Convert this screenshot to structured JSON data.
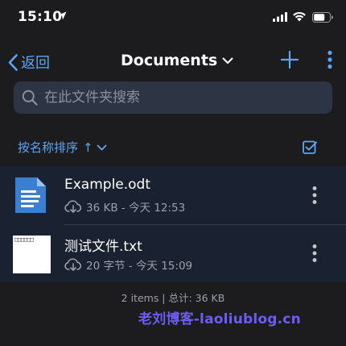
{
  "status_bar": {
    "time": "15:10"
  },
  "nav": {
    "back_label": "返回",
    "title": "Documents"
  },
  "search": {
    "placeholder": "在此文件夹搜索"
  },
  "sort": {
    "label": "按名称排序",
    "arrow": "↑"
  },
  "files": [
    {
      "name": "Example.odt",
      "meta": "36 KB - 今天 12:53",
      "icon": "document-icon"
    },
    {
      "name": "测试文件.txt",
      "meta": "20 字节 - 今天 15:09",
      "icon": "text-file-thumbnail",
      "thumbnail_text": "□□□□□□"
    }
  ],
  "footer": {
    "summary": "2 items | 总计: 36 KB"
  },
  "watermark": {
    "text": "老刘博客-laoliublog.cn"
  },
  "colors": {
    "accent": "#5aa6f6",
    "background": "#1c1c1e",
    "list_bg": "#1a2130",
    "watermark": "#6d5df2"
  }
}
